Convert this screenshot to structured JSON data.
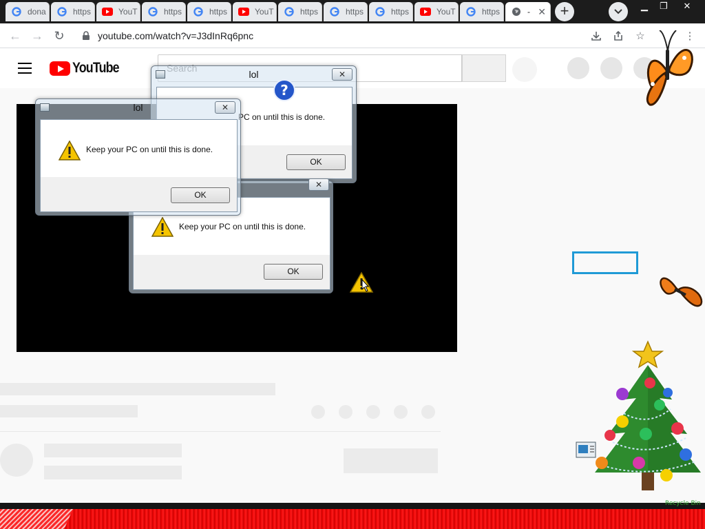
{
  "browser": {
    "tabs": [
      {
        "label": "dona",
        "favicon": "google-icon",
        "active": false
      },
      {
        "label": "https",
        "favicon": "google-icon",
        "active": false
      },
      {
        "label": "YouT",
        "favicon": "youtube-icon",
        "active": false
      },
      {
        "label": "https",
        "favicon": "google-icon",
        "active": false
      },
      {
        "label": "https",
        "favicon": "google-icon",
        "active": false
      },
      {
        "label": "YouT",
        "favicon": "youtube-icon",
        "active": false
      },
      {
        "label": "https",
        "favicon": "google-icon",
        "active": false
      },
      {
        "label": "https",
        "favicon": "google-icon",
        "active": false
      },
      {
        "label": "https",
        "favicon": "google-icon",
        "active": false
      },
      {
        "label": "YouT",
        "favicon": "youtube-icon",
        "active": false
      },
      {
        "label": "https",
        "favicon": "google-icon",
        "active": false
      },
      {
        "label": "-",
        "favicon": "globe-icon",
        "active": true
      }
    ],
    "url": "youtube.com/watch?v=J3dInRq6pnc",
    "colors": {
      "tabstrip": "#1c1c1c",
      "tab": "#e8eaed",
      "active_tab": "#ffffff"
    }
  },
  "youtube": {
    "logo_text": "YouTube",
    "search_placeholder": "Search",
    "brand_color": "#ff0000"
  },
  "dialogs": [
    {
      "title": "lol",
      "message": "PC on until this is done.",
      "ok_label": "OK",
      "icon": "question-icon"
    },
    {
      "title": "lol",
      "message": "Keep your PC on until this is done.",
      "ok_label": "OK",
      "icon": "warning-icon"
    },
    {
      "title": "",
      "message": "Keep your PC on until this is done.",
      "ok_label": "OK",
      "icon": "warning-icon"
    }
  ],
  "desktop": {
    "recycle_bin_label": "Recycle Bin",
    "taskbar_color": "#e00000",
    "highlight_color": "#1f9ad6"
  }
}
